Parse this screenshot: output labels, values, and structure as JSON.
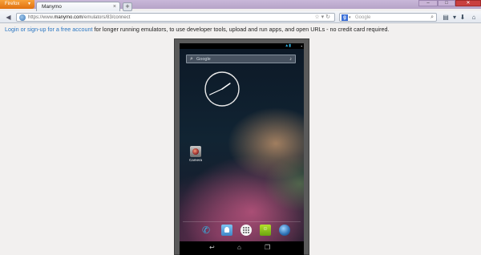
{
  "browser": {
    "menu_label": "Firefox",
    "tab_title": "Manymo",
    "new_tab_label": "+",
    "url_prefix": "https://www.",
    "url_domain": "manymo.com",
    "url_path": "/emulators/83/connect",
    "search_placeholder": "Google",
    "search_engine_label": "g"
  },
  "page": {
    "notice_link": "Login or sign-up for a free account",
    "notice_text": " for longer running emulators, to use developer tools, upload and run apps, and open URLs - no credit card required."
  },
  "emulator": {
    "search_label": "Google",
    "camera_label": "Camera",
    "clock": {
      "hour_angle_deg": 55,
      "minute_angle_deg": 245
    },
    "dock_apps": [
      "phone-icon",
      "people-icon",
      "all-apps-icon",
      "messaging-icon",
      "browser-icon"
    ],
    "nav_keys": [
      "back-icon",
      "home-icon",
      "recent-apps-icon"
    ]
  },
  "colors": {
    "link": "#2a76c2",
    "firefox_orange": "#e0700f",
    "holo_blue": "#33b5e5",
    "device_frame": "#5a5a5a"
  }
}
